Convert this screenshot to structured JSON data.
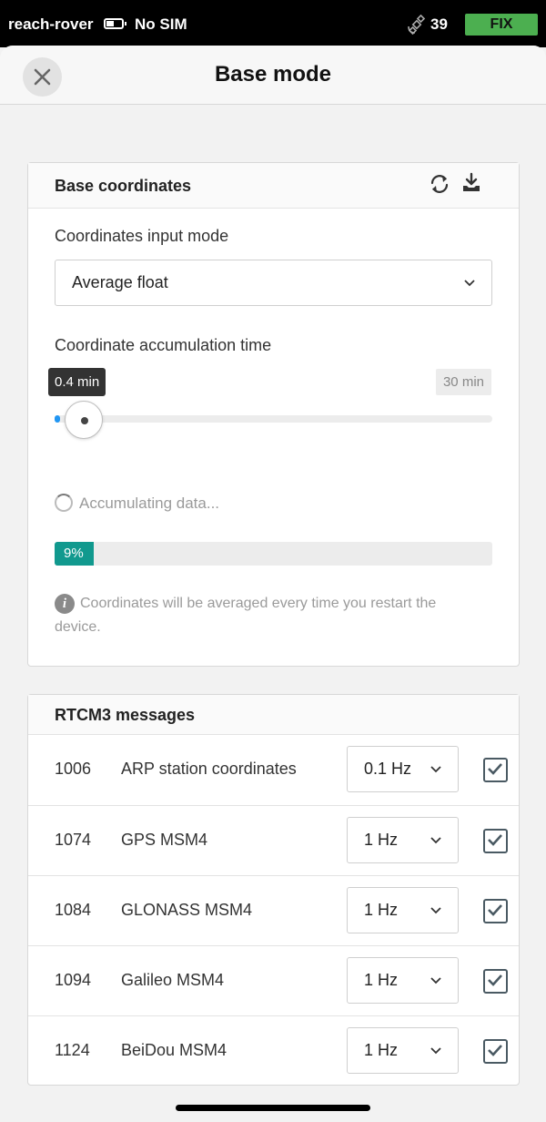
{
  "status_bar": {
    "device_name": "reach-rover",
    "sim_status": "No SIM",
    "satellite_count": "39",
    "fix_status": "FIX",
    "fix_color": "#4caf50"
  },
  "header": {
    "title": "Base mode",
    "close_icon": "close-icon"
  },
  "base_coordinates": {
    "title": "Base coordinates",
    "refresh_icon": "refresh-icon",
    "download_icon": "download-icon",
    "input_mode_label": "Coordinates input mode",
    "input_mode_value": "Average float",
    "accumulation_label": "Coordinate accumulation time",
    "slider_value_label": "0.4 min",
    "slider_max_label": "30 min",
    "slider_value": 0.4,
    "slider_max": 30,
    "status_text": "Accumulating data...",
    "progress_label": "9%",
    "progress_value": 9,
    "progress_color": "#11998e",
    "info_note": "Coordinates will be averaged every time you restart the device."
  },
  "rtcm3": {
    "title": "RTCM3 messages",
    "rows": [
      {
        "id": "1006",
        "name": "ARP station coordinates",
        "rate": "0.1 Hz",
        "checked": true
      },
      {
        "id": "1074",
        "name": "GPS MSM4",
        "rate": "1 Hz",
        "checked": true
      },
      {
        "id": "1084",
        "name": "GLONASS MSM4",
        "rate": "1 Hz",
        "checked": true
      },
      {
        "id": "1094",
        "name": "Galileo MSM4",
        "rate": "1 Hz",
        "checked": true
      },
      {
        "id": "1124",
        "name": "BeiDou MSM4",
        "rate": "1 Hz",
        "checked": true
      }
    ]
  }
}
